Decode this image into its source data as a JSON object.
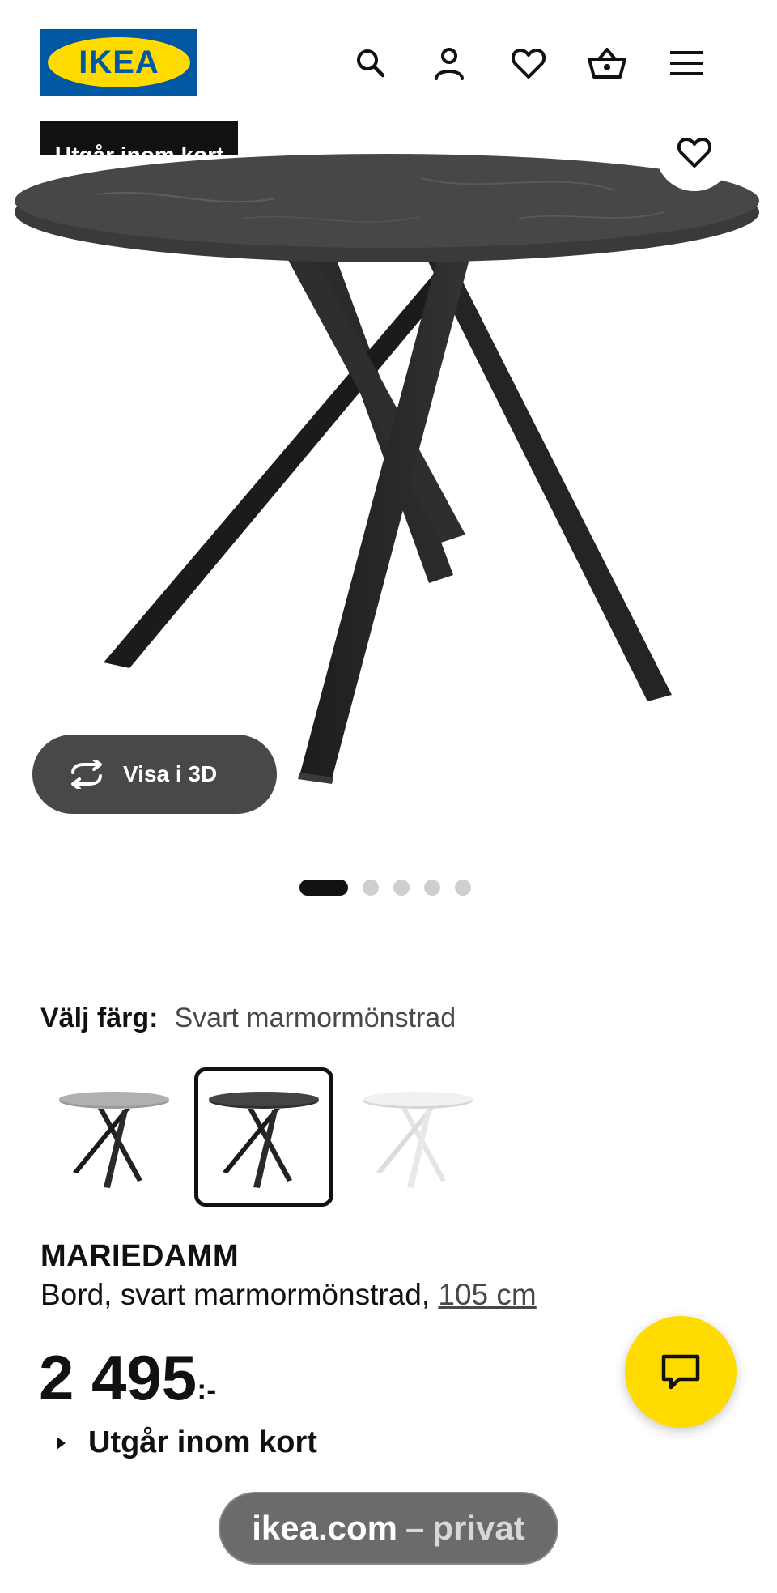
{
  "header": {
    "logo_text": "IKEA",
    "icons": [
      "search-icon",
      "account-icon",
      "favorites-icon",
      "cart-icon",
      "menu-icon"
    ]
  },
  "hero": {
    "badge_text": "Utgår inom kort",
    "view3d_label": "Visa i 3D",
    "image_count": 5,
    "active_image": 1
  },
  "color_select": {
    "label": "Välj färg:",
    "value": "Svart marmormönstrad",
    "options": [
      "grey",
      "black",
      "white"
    ],
    "selected": "black"
  },
  "product": {
    "name": "MARIEDAMM",
    "description": "Bord, svart marmormönstrad, ",
    "size": "105 cm",
    "price": "2 495",
    "price_suffix": ":-",
    "status": "Utgår inom kort"
  },
  "browser": {
    "host": "ikea.com",
    "separator": "–",
    "mode": "privat"
  },
  "colors": {
    "ikea_blue": "#0058a3",
    "ikea_yellow": "#ffdb00",
    "dark_button": "#484848"
  }
}
